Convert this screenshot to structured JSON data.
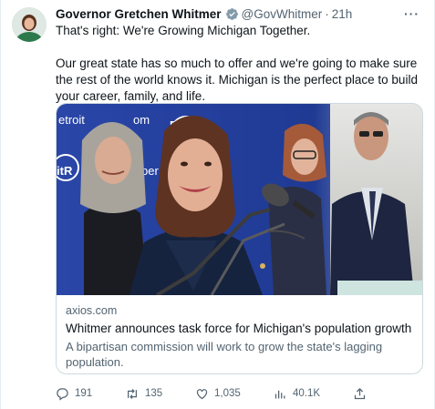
{
  "tweet": {
    "display_name": "Governor Gretchen Whitmer",
    "handle": "@GovWhitmer",
    "separator": "·",
    "time": "21h",
    "more_label": "···",
    "text_line1": "That's right: We're Growing Michigan Together.",
    "text_para2": "Our great state has so much to offer and we're going to make sure the rest of the world knows it. Michigan is the perfect place to build your career, family, and life."
  },
  "card": {
    "domain": "axios.com",
    "title": "Whitmer announces task force for Michigan's population growth",
    "description": "A bipartisan commission will work to grow the state's lagging population.",
    "image_backdrop_text_1": "etroit",
    "image_backdrop_text_2": "om",
    "image_backdrop_text_3": "Detroit",
    "image_backdrop_text_4": "itR",
    "image_backdrop_text_5": "ber"
  },
  "actions": {
    "replies": "191",
    "retweets": "135",
    "likes": "1,035",
    "views": "40.1K"
  },
  "colors": {
    "verified": "#1d9bf0",
    "muted": "#536471",
    "border": "#cfd9de",
    "backdrop_blue": "#1f3a93"
  }
}
